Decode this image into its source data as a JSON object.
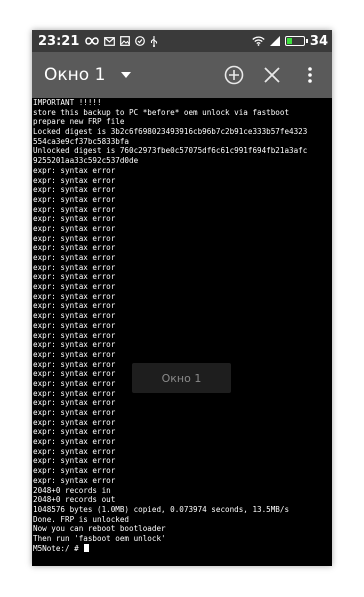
{
  "status_bar": {
    "time": "23:21",
    "battery_percent": "34",
    "battery_level": 0.34,
    "left_icons": [
      "infinity-icon",
      "mail-icon",
      "image-icon",
      "check-circle-icon",
      "usb-icon"
    ],
    "right_icons": [
      "wifi-icon",
      "signal-icon",
      "battery-icon"
    ]
  },
  "toolbar": {
    "title": "Окно 1",
    "actions": [
      "add-window",
      "close-window",
      "overflow-menu"
    ]
  },
  "terminal": {
    "lines": [
      "IMPORTANT !!!!!",
      "store this backup to PC *before* oem unlock via fastboot",
      "prepare new FRP file",
      "Locked digest is 3b2c6f698023493916cb96b7c2b91ce333b57fe4323",
      "554ca3e9cf37bc5833bfa",
      "Unlocked digest is 760c2973fbe0c57075df6c61c991f694fb21a3afc",
      "9255201aa33c592c537d0de",
      "expr: syntax error",
      "expr: syntax error",
      "expr: syntax error",
      "expr: syntax error",
      "expr: syntax error",
      "expr: syntax error",
      "expr: syntax error",
      "expr: syntax error",
      "expr: syntax error",
      "expr: syntax error",
      "expr: syntax error",
      "expr: syntax error",
      "expr: syntax error",
      "expr: syntax error",
      "expr: syntax error",
      "expr: syntax error",
      "expr: syntax error",
      "expr: syntax error",
      "expr: syntax error",
      "expr: syntax error",
      "expr: syntax error",
      "expr: syntax error",
      "expr: syntax error",
      "expr: syntax error",
      "expr: syntax error",
      "expr: syntax error",
      "expr: syntax error",
      "expr: syntax error",
      "expr: syntax error",
      "expr: syntax error",
      "expr: syntax error",
      "expr: syntax error",
      "expr: syntax error",
      "2048+0 records in",
      "2048+0 records out",
      "1048576 bytes (1.0MB) copied, 0.073974 seconds, 13.5MB/s",
      "Done. FRP is unlocked",
      "Now you can reboot bootloader",
      "Then run 'fasboot oem unlock'",
      "M5Note:/ # "
    ]
  },
  "toast": {
    "text": "Окно 1"
  },
  "colors": {
    "status_bar_bg": "#3a3a3a",
    "toolbar_bg": "#5a5a5a",
    "terminal_bg": "#000000",
    "terminal_text": "#ffffff",
    "arrow": "#e0001a",
    "battery_fill": "#3ee03e"
  }
}
